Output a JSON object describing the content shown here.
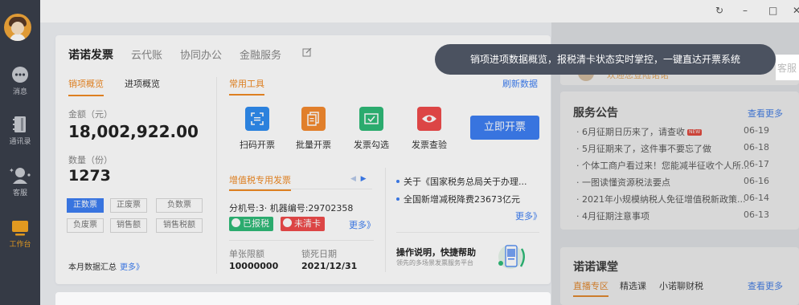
{
  "sidebar": {
    "items": [
      {
        "label": "消息",
        "icon": "message-icon"
      },
      {
        "label": "通讯录",
        "icon": "contacts-icon"
      },
      {
        "label": "客服",
        "icon": "customer-service-icon"
      },
      {
        "label": "工作台",
        "icon": "workbench-icon"
      }
    ]
  },
  "window": {
    "refresh": "↻",
    "minimize": "–",
    "maximize": "□",
    "close": "✕"
  },
  "main": {
    "tabs": [
      "诺诺发票",
      "云代账",
      "协同办公",
      "金融服务"
    ],
    "subtabs": [
      "销项概览",
      "进项概览"
    ],
    "amount_label": "金额（元）",
    "amount_value": "18,002,922.00",
    "count_label": "数量（份）",
    "count_value": "1273",
    "chips": [
      "正数票",
      "正废票",
      "负数票",
      "负废票",
      "销售额",
      "销售税额"
    ],
    "monthly_summary": "本月数据汇总",
    "monthly_more": "更多》"
  },
  "tools": {
    "title": "常用工具",
    "refresh": "刷新数据",
    "items": [
      {
        "label": "扫码开票",
        "icon": "scan-icon",
        "color": "#2f8cf0"
      },
      {
        "label": "批量开票",
        "icon": "batch-icon",
        "color": "#f58a2f"
      },
      {
        "label": "发票勾选",
        "icon": "check-envelope-icon",
        "color": "#2fba78"
      },
      {
        "label": "发票查验",
        "icon": "eye-icon",
        "color": "#ef4b4b"
      }
    ],
    "invoice_button": "立即开票"
  },
  "vat": {
    "title": "增值税专用发票",
    "branch": "分机号:3· 机器编号:29702358",
    "reported": "已报税",
    "not_cleared": "未清卡",
    "more": "更多》",
    "limit_label": "单张限额",
    "limit_value": "10000000",
    "deadline_label": "锁死日期",
    "deadline_value": "2021/12/31"
  },
  "news": {
    "items": [
      "关于《国家税务总局关于办理...",
      "全国新增减税降费23673亿元"
    ],
    "more": "更多》"
  },
  "help": {
    "title": "操作说明，快捷帮助",
    "subtitle": "领先的多场景发票服务平台"
  },
  "service": {
    "title": "服务公告",
    "more": "查看更多",
    "items": [
      {
        "text": "6月征期日历来了，请查收",
        "date": "06-19",
        "hot": "NEW"
      },
      {
        "text": "5月征期来了，这件事不要忘了做",
        "date": "06-18"
      },
      {
        "text": "个体工商户看过来！您能减半征收个人所...",
        "date": "06-17"
      },
      {
        "text": "一图读懂资源税法要点",
        "date": "06-16"
      },
      {
        "text": "2021年小规模纳税人免征增值税新政策...",
        "date": "06-14"
      },
      {
        "text": "4月征期注意事项",
        "date": "06-13"
      }
    ]
  },
  "top_right": {
    "partial_text": "欢迎您登陆诺诺",
    "edge_text": "客服"
  },
  "course": {
    "title": "诺诺课堂",
    "more": "查看更多",
    "tabs": [
      "直播专区",
      "精选课",
      "小诺聊财税"
    ]
  },
  "tooltip": "销项进项数据概览，报税清卡状态实时掌控，一键直达开票系统"
}
